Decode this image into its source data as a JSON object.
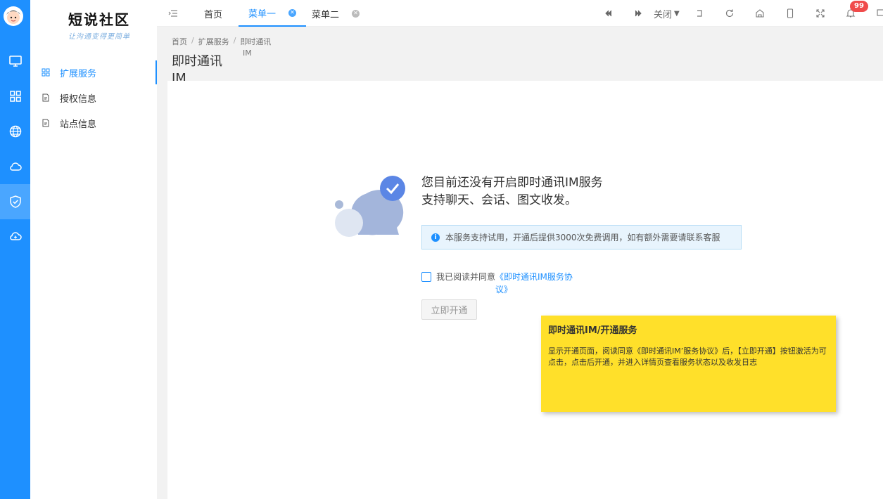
{
  "logo": {
    "title": "短说社区",
    "subtitle": "让沟通变得更简单"
  },
  "rail": {
    "items": [
      {
        "icon": "monitor-icon"
      },
      {
        "icon": "grid-icon"
      },
      {
        "icon": "globe-icon"
      },
      {
        "icon": "cloud-icon"
      },
      {
        "icon": "shield-check-icon"
      },
      {
        "icon": "cloud-sync-icon"
      }
    ],
    "active_index": 4
  },
  "sidebar": {
    "items": [
      {
        "label": "扩展服务",
        "icon": "extension-icon"
      },
      {
        "label": "授权信息",
        "icon": "document-icon"
      },
      {
        "label": "站点信息",
        "icon": "document-icon"
      }
    ]
  },
  "topbar": {
    "tabs": [
      {
        "label": "首页"
      },
      {
        "label": "菜单一"
      },
      {
        "label": "菜单二"
      }
    ],
    "close_label": "关闭",
    "notification_count": "99"
  },
  "breadcrumb": {
    "items": [
      "首页",
      "扩展服务",
      "即时通讯"
    ],
    "tail": "IM"
  },
  "page_title": "即时通讯 IM",
  "main": {
    "headline_line1": "您目前还没有开启即时通讯IM服务",
    "headline_line2": "支持聊天、会话、图文收发。",
    "notice": "本服务支持试用，开通后提供3000次免费调用，如有额外需要请联系客服",
    "agree_text": "我已阅读并同意",
    "agree_link": "《即时通讯IM服务协议》",
    "open_button": "立即开通"
  },
  "note": {
    "title": "即时通讯IM/开通服务",
    "body": "显示开通页面，阅读同意《即时通讯IM’服务协议》后，【立即开通】按钮激活为可点击，点击后开通，并进入详情页查看服务状态以及收发日志"
  },
  "colors": {
    "primary": "#1e90ff",
    "rail_active": "#4aa6ff",
    "note_bg": "#ffe02a",
    "badge": "#f04b4b"
  }
}
